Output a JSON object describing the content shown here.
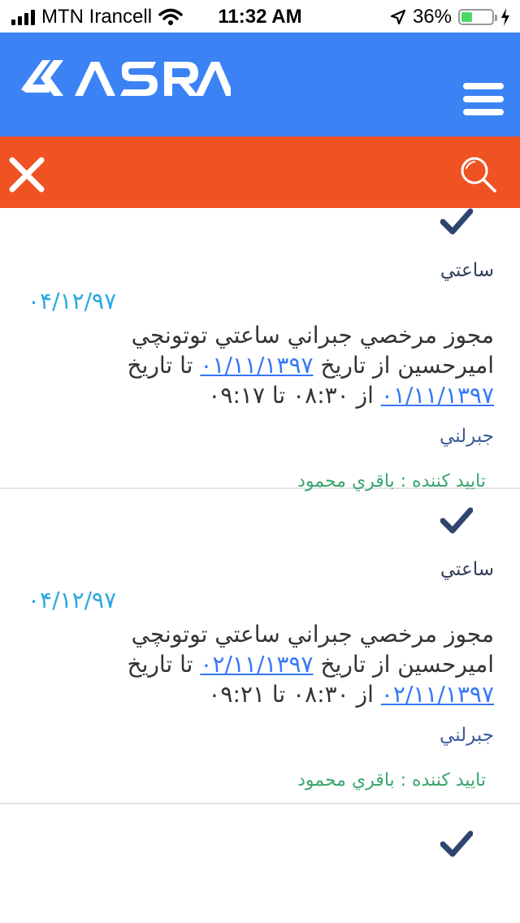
{
  "status_bar": {
    "carrier": "MTN Irancell",
    "time": "11:32 AM",
    "battery": "36%",
    "battery_level": 0.36
  },
  "header": {
    "logo_text": "KASRA",
    "menu_icon": "hamburger-menu-icon",
    "brand_color": "#3b82f5"
  },
  "search_bar": {
    "close_icon": "close-icon",
    "search_icon": "search-icon",
    "color": "#ef5324"
  },
  "items": [
    {
      "type": "ساعتي",
      "date": "۰۴/۱۲/۹۷",
      "desc_part1": "مجوز مرخصي جبراني ساعتي توتونچي اميرحسين از تاريخ ",
      "from_date": "۰۱/۱۱/۱۳۹۷",
      "desc_part2": " تا تاريخ ",
      "to_date": "۰۱/۱۱/۱۳۹۷",
      "desc_part3": " از ۰۸:۳۰ تا ۰۹:۱۷",
      "category": "جبرلني",
      "approver": "تاييد كننده : باقري محمود"
    },
    {
      "type": "ساعتي",
      "date": "۰۴/۱۲/۹۷",
      "desc_part1": "مجوز مرخصي جبراني ساعتي توتونچي اميرحسين از تاريخ ",
      "from_date": "۰۲/۱۱/۱۳۹۷",
      "desc_part2": " تا تاريخ ",
      "to_date": "۰۲/۱۱/۱۳۹۷",
      "desc_part3": " از ۰۸:۳۰ تا ۰۹:۲۱",
      "category": "جبرلني",
      "approver": "تاييد كننده : باقري محمود"
    }
  ]
}
